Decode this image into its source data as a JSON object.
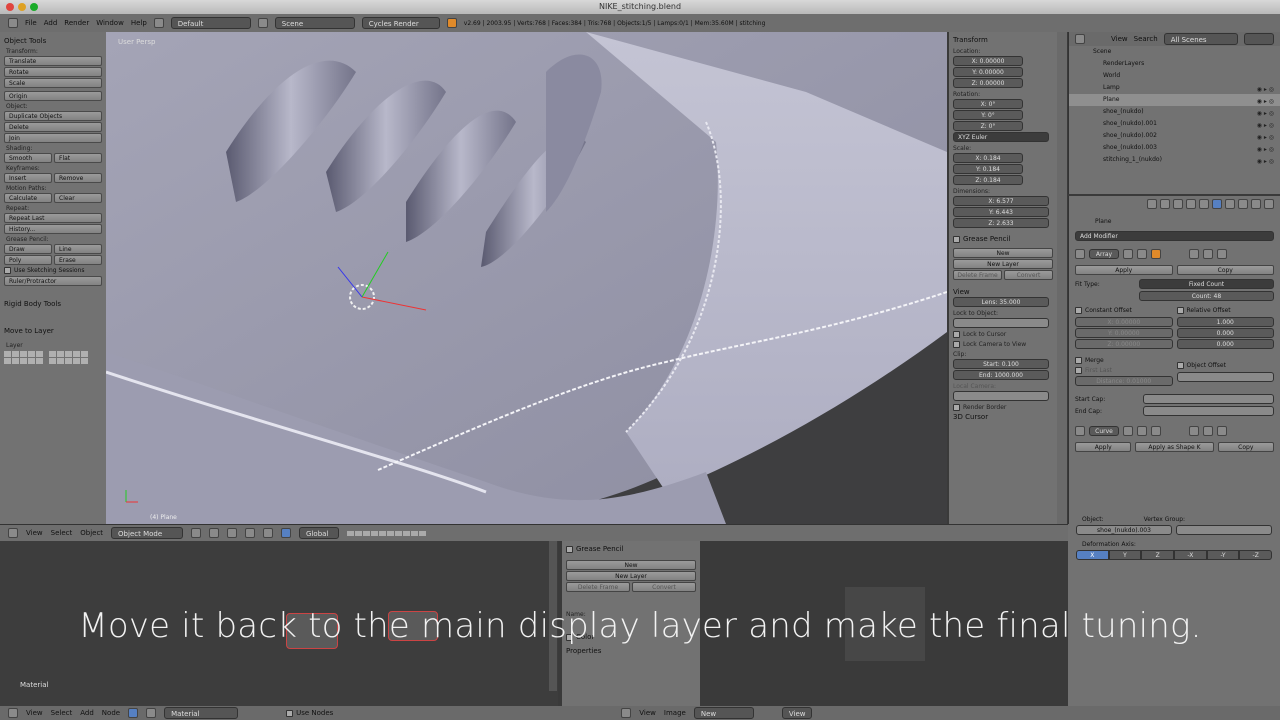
{
  "window": {
    "title": "NIKE_stitching.blend",
    "path": "v2.69 | 2003.95 | Verts:768 | Faces:384 | Tris:768 | Objects:1/5 | Lamps:0/1 | Mem:35.60M | stitching"
  },
  "menu": {
    "file": "File",
    "add": "Add",
    "render": "Render",
    "window": "Window",
    "help": "Help",
    "layout": "Default",
    "scene": "Scene",
    "engine": "Cycles Render"
  },
  "toolshelf": {
    "title": "Object Tools",
    "transform": "Transform:",
    "translate": "Translate",
    "rotate": "Rotate",
    "scale": "Scale",
    "origin": "Origin",
    "object": "Object:",
    "duplicate": "Duplicate Objects",
    "delete": "Delete",
    "join": "Join",
    "shading": "Shading:",
    "smooth": "Smooth",
    "flat": "Flat",
    "keyframes": "Keyframes:",
    "insert": "Insert",
    "remove": "Remove",
    "motion": "Motion Paths:",
    "calculate": "Calculate",
    "clear": "Clear",
    "repeat": "Repeat:",
    "repeat_last": "Repeat Last",
    "history": "History...",
    "grease": "Grease Pencil:",
    "draw": "Draw",
    "line": "Line",
    "poly": "Poly",
    "erase": "Erase",
    "sketching": "Use Sketching Sessions",
    "ruler": "Ruler/Protractor",
    "rigid": "Rigid Body Tools",
    "move_layer": "Move to Layer",
    "layer": "Layer"
  },
  "viewport": {
    "title": "User Persp",
    "object_label": "(4) Plane"
  },
  "npanel": {
    "transform": "Transform",
    "location": "Location:",
    "loc": [
      "X: 0.00000",
      "Y: 0.00000",
      "Z: 0.00000"
    ],
    "rotation": "Rotation:",
    "rot": [
      "X: 0°",
      "Y: 0°",
      "Z: 0°"
    ],
    "euler": "XYZ Euler",
    "scale": "Scale:",
    "scl": [
      "X: 0.184",
      "Y: 0.184",
      "Z: 0.184"
    ],
    "dimensions": "Dimensions:",
    "dim": [
      "X: 6.577",
      "Y: 6.443",
      "Z: 2.633"
    ],
    "grease": "Grease Pencil",
    "new": "New",
    "new_layer": "New Layer",
    "delete_frame": "Delete Frame",
    "convert": "Convert",
    "view": "View",
    "lens": "Lens: 35.000",
    "lock_obj": "Lock to Object:",
    "lock_cursor": "Lock to Cursor",
    "lock_camera": "Lock Camera to View",
    "clip": "Clip:",
    "start": "Start: 0.100",
    "end": "End: 1000.000",
    "local_camera": "Local Camera:",
    "render_border": "Render Border",
    "cursor": "3D Cursor"
  },
  "viewheader": {
    "view": "View",
    "select": "Select",
    "object": "Object",
    "mode": "Object Mode",
    "global": "Global"
  },
  "outliner": {
    "view": "View",
    "search": "Search",
    "filter": "All Scenes",
    "items": [
      {
        "label": "Scene",
        "indent": 0
      },
      {
        "label": "RenderLayers",
        "indent": 1
      },
      {
        "label": "World",
        "indent": 1
      },
      {
        "label": "Lamp",
        "indent": 1
      },
      {
        "label": "Plane",
        "indent": 1
      },
      {
        "label": "shoe_(nukdo)",
        "indent": 1
      },
      {
        "label": "shoe_(nukdo).001",
        "indent": 1
      },
      {
        "label": "shoe_(nukdo).002",
        "indent": 1
      },
      {
        "label": "shoe_(nukdo).003",
        "indent": 1
      },
      {
        "label": "stitching_1_(nukdo)",
        "indent": 1
      }
    ]
  },
  "props": {
    "object": "Plane",
    "add_modifier": "Add Modifier",
    "array": "Array",
    "apply": "Apply",
    "copy": "Copy",
    "fit_type": "Fit Type:",
    "fit_value": "Fixed Count",
    "count": "Count: 48",
    "constant": "Constant Offset",
    "relative": "Relative Offset",
    "const_vals": [
      "X: 0.00000",
      "Y: 0.00000",
      "Z: 0.00000"
    ],
    "rel_vals": [
      "1.000",
      "0.000",
      "0.000"
    ],
    "merge": "Merge",
    "object_offset": "Object Offset",
    "first_last": "First Last",
    "distance": "Distance: 0.01000",
    "start_cap": "Start Cap:",
    "end_cap": "End Cap:",
    "curve": "Curve",
    "apply_shape": "Apply as Shape K",
    "object_lbl": "Object:",
    "vertex_group": "Vertex Group:",
    "object_val": "shoe_(nukdo).003",
    "deform_axis": "Deformation Axis:",
    "axes": [
      "X",
      "Y",
      "Z",
      "-X",
      "-Y",
      "-Z"
    ]
  },
  "nodepanel": {
    "grease": "Grease Pencil",
    "new": "New",
    "new_layer": "New Layer",
    "delete_frame": "Delete Frame",
    "convert": "Convert",
    "name": "Name:",
    "color": "Color",
    "properties": "Properties",
    "material": "Material"
  },
  "bottombar": {
    "view": "View",
    "select": "Select",
    "add": "Add",
    "node": "Node",
    "material": "Material",
    "use_nodes": "Use Nodes",
    "image": "Image",
    "new": "New",
    "view2": "View"
  },
  "subtitle": "Move it back to the main display layer and make the final tuning."
}
